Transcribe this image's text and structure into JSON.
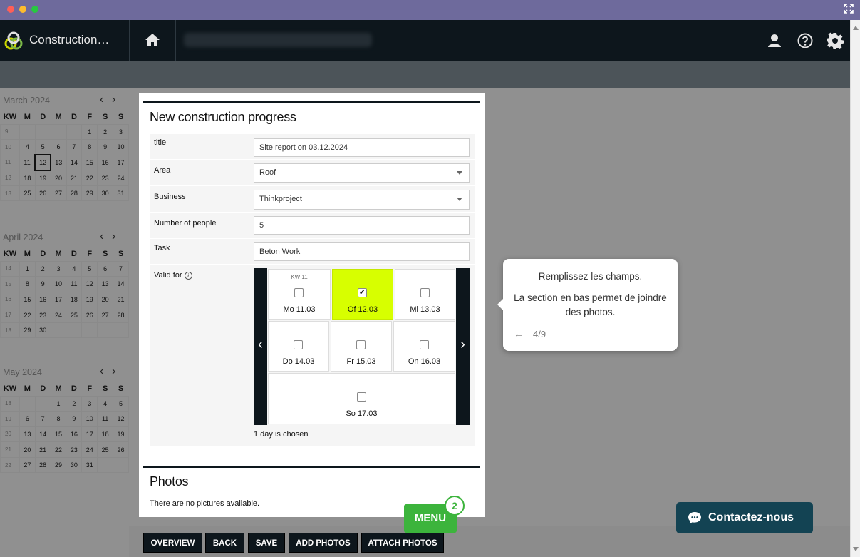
{
  "app": {
    "title": "Construction…"
  },
  "calendars": [
    {
      "month": "March 2024",
      "headers": [
        "KW",
        "M",
        "D",
        "M",
        "D",
        "F",
        "S",
        "S"
      ],
      "weeks": [
        [
          "9",
          "",
          "",
          "",
          "",
          "1",
          "2",
          "3"
        ],
        [
          "10",
          "4",
          "5",
          "6",
          "7",
          "8",
          "9",
          "10"
        ],
        [
          "11",
          "11",
          "12",
          "13",
          "14",
          "15",
          "16",
          "17"
        ],
        [
          "12",
          "18",
          "19",
          "20",
          "21",
          "22",
          "23",
          "24"
        ],
        [
          "13",
          "25",
          "26",
          "27",
          "28",
          "29",
          "30",
          "31"
        ]
      ],
      "today": "12"
    },
    {
      "month": "April 2024",
      "headers": [
        "KW",
        "M",
        "D",
        "M",
        "D",
        "F",
        "S",
        "S"
      ],
      "weeks": [
        [
          "14",
          "1",
          "2",
          "3",
          "4",
          "5",
          "6",
          "7"
        ],
        [
          "15",
          "8",
          "9",
          "10",
          "11",
          "12",
          "13",
          "14"
        ],
        [
          "16",
          "15",
          "16",
          "17",
          "18",
          "19",
          "20",
          "21"
        ],
        [
          "17",
          "22",
          "23",
          "24",
          "25",
          "26",
          "27",
          "28"
        ],
        [
          "18",
          "29",
          "30",
          "",
          "",
          "",
          "",
          ""
        ]
      ]
    },
    {
      "month": "May 2024",
      "headers": [
        "KW",
        "M",
        "D",
        "M",
        "D",
        "F",
        "S",
        "S"
      ],
      "weeks": [
        [
          "18",
          "",
          "",
          "1",
          "2",
          "3",
          "4",
          "5"
        ],
        [
          "19",
          "6",
          "7",
          "8",
          "9",
          "10",
          "11",
          "12"
        ],
        [
          "20",
          "13",
          "14",
          "15",
          "16",
          "17",
          "18",
          "19"
        ],
        [
          "21",
          "20",
          "21",
          "22",
          "23",
          "24",
          "25",
          "26"
        ],
        [
          "22",
          "27",
          "28",
          "29",
          "30",
          "31",
          "",
          ""
        ]
      ]
    }
  ],
  "form": {
    "title": "New construction progress",
    "fields": {
      "title": {
        "label": "title",
        "value": "Site report on 03.12.2024"
      },
      "area": {
        "label": "Area",
        "value": "Roof"
      },
      "business": {
        "label": "Business",
        "value": "Thinkproject"
      },
      "people": {
        "label": "Number of people",
        "value": "5"
      },
      "task": {
        "label": "Task",
        "value": "Beton Work"
      },
      "valid_for": {
        "label": "Valid for",
        "info": "i"
      }
    },
    "week_label": "KW 11",
    "days": [
      {
        "label": "Mo 11.03",
        "checked": false
      },
      {
        "label": "Of 12.03",
        "checked": true
      },
      {
        "label": "Mi 13.03",
        "checked": false
      },
      {
        "label": "Do 14.03",
        "checked": false
      },
      {
        "label": "Fr 15.03",
        "checked": false
      },
      {
        "label": "On 16.03",
        "checked": false
      },
      {
        "label": "So 17.03",
        "checked": false
      }
    ],
    "check_mark": "✔",
    "chosen_text": "1 day is chosen",
    "nav_prev": "‹",
    "nav_next": "›"
  },
  "photos": {
    "title": "Photos",
    "empty_text": "There are no pictures available."
  },
  "tooltip": {
    "line1": "Remplissez les champs.",
    "line2": "La section en bas permet de joindre des photos.",
    "back_icon": "←",
    "step": "4/9"
  },
  "toolbar": {
    "overview": "OVERVIEW",
    "back": "BACK",
    "save": "SAVE",
    "add_photos": "ADD PHOTOS",
    "attach_photos": "ATTACH PHOTOS"
  },
  "menu": {
    "label": "MENU",
    "badge": "2"
  },
  "contact": {
    "label": "Contactez-nous"
  },
  "colors": {
    "accent": "#d7ff00",
    "dark": "#0d161c",
    "menu_green": "#3cb43c",
    "contact_bg": "#134353"
  }
}
